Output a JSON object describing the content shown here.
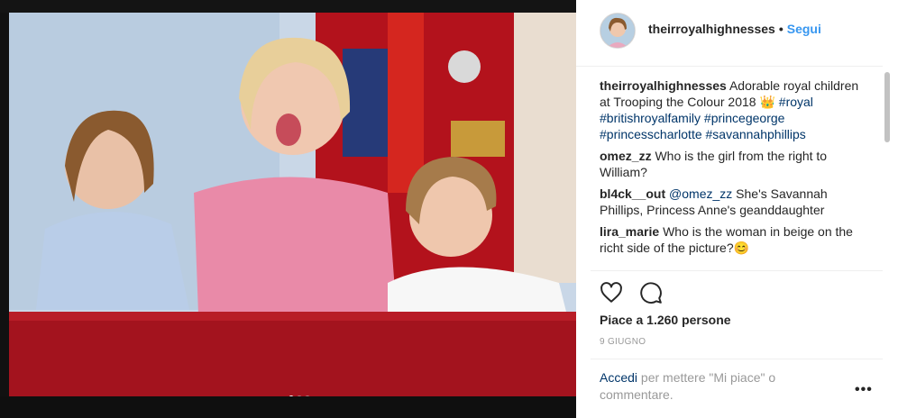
{
  "header": {
    "username": "theirroyalhighnesses",
    "dot": "•",
    "follow_label": "Segui"
  },
  "comments": [
    {
      "user": "theirroyalhighnesses",
      "text": "Adorable royal children at Trooping the Colour 2018 👑",
      "tags": "#royal #britishroyalfamily #princegeorge #princesscharlotte #savannahphillips"
    },
    {
      "user": "omez_zz",
      "text": "Who is the girl from the right to William?"
    },
    {
      "user": "bl4ck__out",
      "mention": "@omez_zz",
      "text": "She's Savannah Phillips, Princess Anne's geanddaughter"
    },
    {
      "user": "lira_marie",
      "text": "Who is the woman in beige on the richt side of the picture?😊"
    }
  ],
  "likes": "Piace a 1.260 persone",
  "date": "9 GIUGNO",
  "login": {
    "link": "Accedi",
    "text": " per mettere \"Mi piace\" o commentare."
  },
  "more_icon": "•••",
  "icons": [
    "heart-icon",
    "comment-icon"
  ],
  "carousel": {
    "count": 3,
    "active": 1
  },
  "colors": {
    "link": "#3897f0",
    "hashtag": "#003569",
    "balcony": "#a3131e"
  }
}
